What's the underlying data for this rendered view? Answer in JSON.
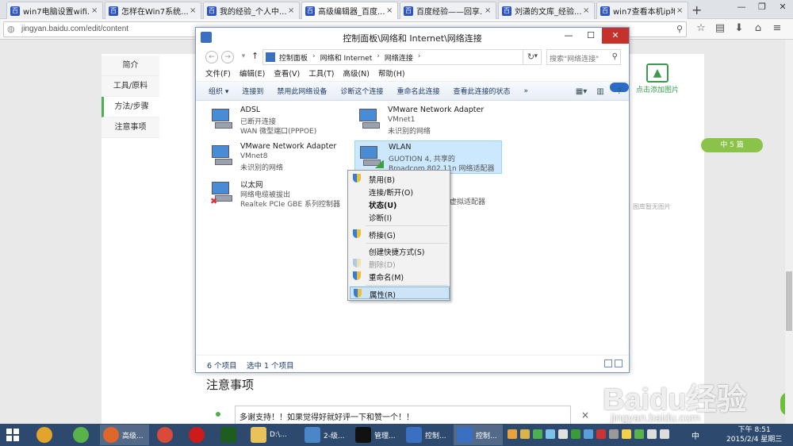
{
  "browser": {
    "tabs": [
      {
        "title": "win7电脑设置wifi..."
      },
      {
        "title": "怎样在Win7系统..."
      },
      {
        "title": "我的经验_个人中..."
      },
      {
        "title": "高级编辑器_百度..."
      },
      {
        "title": "百度经验——回享..."
      },
      {
        "title": "刘潇的文库_经验..."
      },
      {
        "title": "win7查看本机ip地..."
      }
    ],
    "tab_fav_letter": "百",
    "url": "jingyan.baidu.com/edit/content"
  },
  "page": {
    "sidenav": [
      "简介",
      "工具/原料",
      "方法/步骤",
      "注意事项"
    ],
    "add_pic_label": "点击添加图片",
    "badge": "中 5 篇",
    "no_pic": "图库暂无图片",
    "notes_title": "注意事项",
    "note_text": "多谢支持！！如果觉得好就好评一下和赞一个！！",
    "note_close": "×",
    "watermark_brand": "Baidu经验",
    "watermark_url": "jingyan.baidu.com",
    "bubble": "48"
  },
  "explorer": {
    "title": "控制面板\\网络和 Internet\\网络连接",
    "breadcrumbs": [
      "控制面板",
      "网络和 Internet",
      "网络连接"
    ],
    "search_placeholder": "搜索\"网络连接\"",
    "menu": [
      "文件(F)",
      "编辑(E)",
      "查看(V)",
      "工具(T)",
      "高级(N)",
      "帮助(H)"
    ],
    "toolbar": [
      "组织 ▾",
      "连接到",
      "禁用此网络设备",
      "诊断这个连接",
      "重命名此连接",
      "查看此连接的状态",
      "»"
    ],
    "adapters": [
      {
        "name": "ADSL",
        "line2": "已断开连接",
        "line3": "WAN 微型端口(PPPOE)"
      },
      {
        "name": "VMware Network Adapter",
        "line2": "VMnet1",
        "line3": "未识别的网络"
      },
      {
        "name": "VMware Network Adapter",
        "line2": "VMnet8",
        "line3": "未识别的网络"
      },
      {
        "name": "WLAN",
        "line2": "GUOTION  4, 共享的",
        "line3": "Broadcom 802.11n 网络适配器"
      },
      {
        "name": "以太网",
        "line2": "网络电缆被拔出",
        "line3": "Realtek PCIe GBE 系列控制器"
      }
    ],
    "hidden_partial": "虚拟适配器",
    "status_count": "6 个项目",
    "status_selected": "选中 1 个项目",
    "context_menu": [
      {
        "label": "禁用(B)"
      },
      {
        "label": "连接/断开(O)"
      },
      {
        "label": "状态(U)"
      },
      {
        "label": "诊断(I)"
      },
      {
        "label": "桥接(G)"
      },
      {
        "label": "创建快捷方式(S)"
      },
      {
        "label": "删除(D)"
      },
      {
        "label": "重命名(M)"
      },
      {
        "label": "属性(R)"
      }
    ]
  },
  "taskbar": {
    "items": [
      {
        "label": "高级..."
      },
      {
        "label": "D:\\..."
      },
      {
        "label": "2-级..."
      },
      {
        "label": "管理..."
      },
      {
        "label": "控制..."
      },
      {
        "label": "控制..."
      }
    ],
    "ime": "中",
    "time": "下午 8:51",
    "date": "2015/2/4 星期三"
  }
}
